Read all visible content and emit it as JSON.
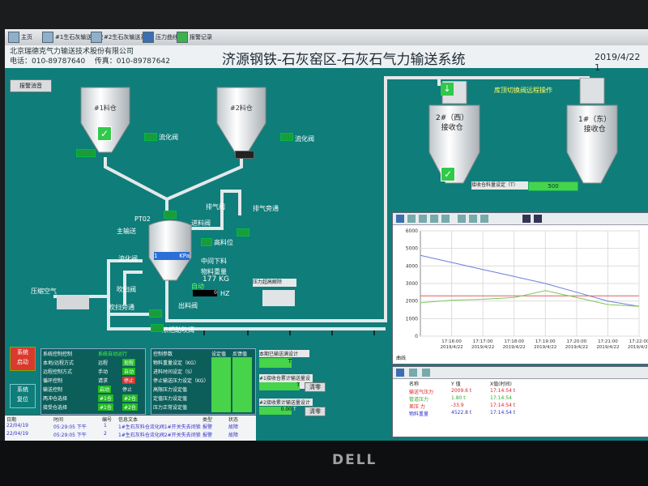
{
  "toolbar": {
    "items": [
      {
        "label": "主页",
        "icon": "home-icon"
      },
      {
        "label": "#1生石灰输送系统",
        "icon": "window-icon"
      },
      {
        "label": "#2生石灰输送系统",
        "icon": "window-icon"
      },
      {
        "label": "压力曲线",
        "icon": "chart-icon"
      },
      {
        "label": "报警记录",
        "icon": "alarm-icon"
      }
    ]
  },
  "header": {
    "company_name": "北京瑞德克气力输送技术股份有限公司",
    "phone": "电话：010-89787640",
    "fax": "传真：010-89787642",
    "title": "济源钢铁-石灰窑区-石灰石气力输送系统",
    "date": "2019/4/22 1"
  },
  "process": {
    "alarm_silence_button": "报警消音",
    "silo1_label": "#1料仓",
    "silo2_label": "#2料仓",
    "silo3_label": "2#（西）\n接收仓",
    "silo4_label": "1#（东）\n接收仓",
    "fluidize_valve_1": "流化阀",
    "fluidize_valve_2": "流化阀",
    "switch_valve_label": "库顶切换阀远程操作",
    "silo_setting_label": "接收仓料量设定（T）",
    "silo_setting_value": "500",
    "exhaust_valve": "排气阀",
    "exhaust_bypass": "排气旁通",
    "feed_valve": "进料阀",
    "pt02": "PT02",
    "main_convey": "主输送",
    "fluidize_valve_3": "流化阀",
    "high_level": "高料位",
    "pressure_value": "1",
    "pressure_unit": "KPa",
    "middle_feed": "中间下料",
    "material_weight_label": "物料重量",
    "material_weight_value": "177",
    "material_weight_unit": "KG",
    "auto_label": "自动",
    "hz_value": "0",
    "hz_unit": "HZ",
    "blow_valve": "吹扫阀",
    "blow_bypass": "吹扫旁通",
    "discharge_valve": "出料阀",
    "compressed_air": "压缩空气",
    "dense_phase_valve": "浓相助吹阀",
    "pressure_high_note": "压力超高解除"
  },
  "controls": {
    "system_start": "系统\n启动",
    "system_reset": "系统\n复位",
    "panel_title": "系统控制控制",
    "panel_mode": "系统自动运行",
    "rows": [
      {
        "label": "本地/远程方式",
        "a": "远程",
        "b": "现程"
      },
      {
        "label": "远程控制方式",
        "a": "手动",
        "b": "自动"
      },
      {
        "label": "循环控制",
        "a": "请求",
        "b": "停止"
      },
      {
        "label": "输送控制",
        "a": "启动",
        "b": "停止"
      },
      {
        "label": "两冲仓选择",
        "a": "#1仓",
        "b": "#2仓"
      },
      {
        "label": "接受仓选择",
        "a": "#1仓",
        "b": "#2仓"
      }
    ],
    "param_title": "控制参数",
    "param_col_set": "设定值",
    "param_col_fb": "反馈值",
    "params": [
      "物料重量设定（KG）",
      "进料时间设定（S）",
      "停止输送压力设定（KG）",
      "高限压力设定值",
      "定值压力设定值",
      "压力正常设定值"
    ],
    "counter1_label": "本期已输送满设计",
    "counter1_value": "T",
    "counter2_label": "#1接收仓累计输送量设计",
    "counter2_value": "T",
    "counter2_btn": "清零",
    "counter3_label": "#2接收累计输送量设计",
    "counter3_value": "0.00",
    "counter3_unit": "T",
    "counter3_btn": "清零"
  },
  "trend": {
    "y_ticks": [
      "6000",
      "5000",
      "4000",
      "3000",
      "2000",
      "1000",
      "0"
    ],
    "x_ticks": [
      "17:16:00\n2019/4/22",
      "17:17:00\n2019/4/22",
      "17:18:00\n2019/4/22",
      "17:19:00\n2019/4/22",
      "17:20:00\n2019/4/22",
      "17:21:00\n2019/4/22",
      "17:22:00\n2019/4/22"
    ],
    "mode_label": "曲线",
    "legend_headers": [
      "名称",
      "Y 值",
      "X值(时间)"
    ],
    "legend_rows": [
      {
        "name": "输送气压力",
        "y": "2009.6 t",
        "x": "17:14:54 t",
        "color": "#d22"
      },
      {
        "name": "管道压力",
        "y": "1.80 t",
        "x": "17:14:54",
        "color": "#3a3"
      },
      {
        "name": "差压 力",
        "y": "-33.9",
        "x": "17:14:54 t",
        "color": "#d22"
      },
      {
        "name": "物料重量",
        "y": "4522.8 t",
        "x": "17:14:54 t",
        "color": "#33c"
      }
    ]
  },
  "alarm": {
    "headers": [
      "日期",
      "时间",
      "编号",
      "信息文本",
      "类型",
      "状态"
    ],
    "rows": [
      {
        "date": "22/04/19",
        "time": "05:29:05 下午",
        "no": "1",
        "text": "1#生石灰料仓流化阀1#开关失去闭锁",
        "type": "报警",
        "state": "故障"
      },
      {
        "date": "22/04/19",
        "time": "05:29:05 下午",
        "no": "2",
        "text": "1#生石灰料仓流化阀2#开关失去闭锁",
        "type": "报警",
        "state": "故障"
      }
    ]
  },
  "chart_data": {
    "type": "line",
    "title": "",
    "xlabel": "",
    "ylabel": "",
    "ylim": [
      0,
      6000
    ],
    "x": [
      "17:15:00",
      "17:16:00",
      "17:17:00",
      "17:18:00",
      "17:19:00",
      "17:20:00",
      "17:21:00",
      "17:22:00"
    ],
    "series": [
      {
        "color": "#6b7fd8",
        "values": [
          4600,
          4200,
          3800,
          3400,
          3000,
          2500,
          2000,
          1700
        ]
      },
      {
        "color": "#d86060",
        "values": [
          2300,
          2300,
          2300,
          2300,
          2300,
          2300,
          2300,
          2300
        ]
      },
      {
        "color": "#7ec85b",
        "values": [
          1900,
          2050,
          2100,
          2200,
          2600,
          2200,
          1800,
          1700
        ]
      }
    ],
    "grid": true
  }
}
